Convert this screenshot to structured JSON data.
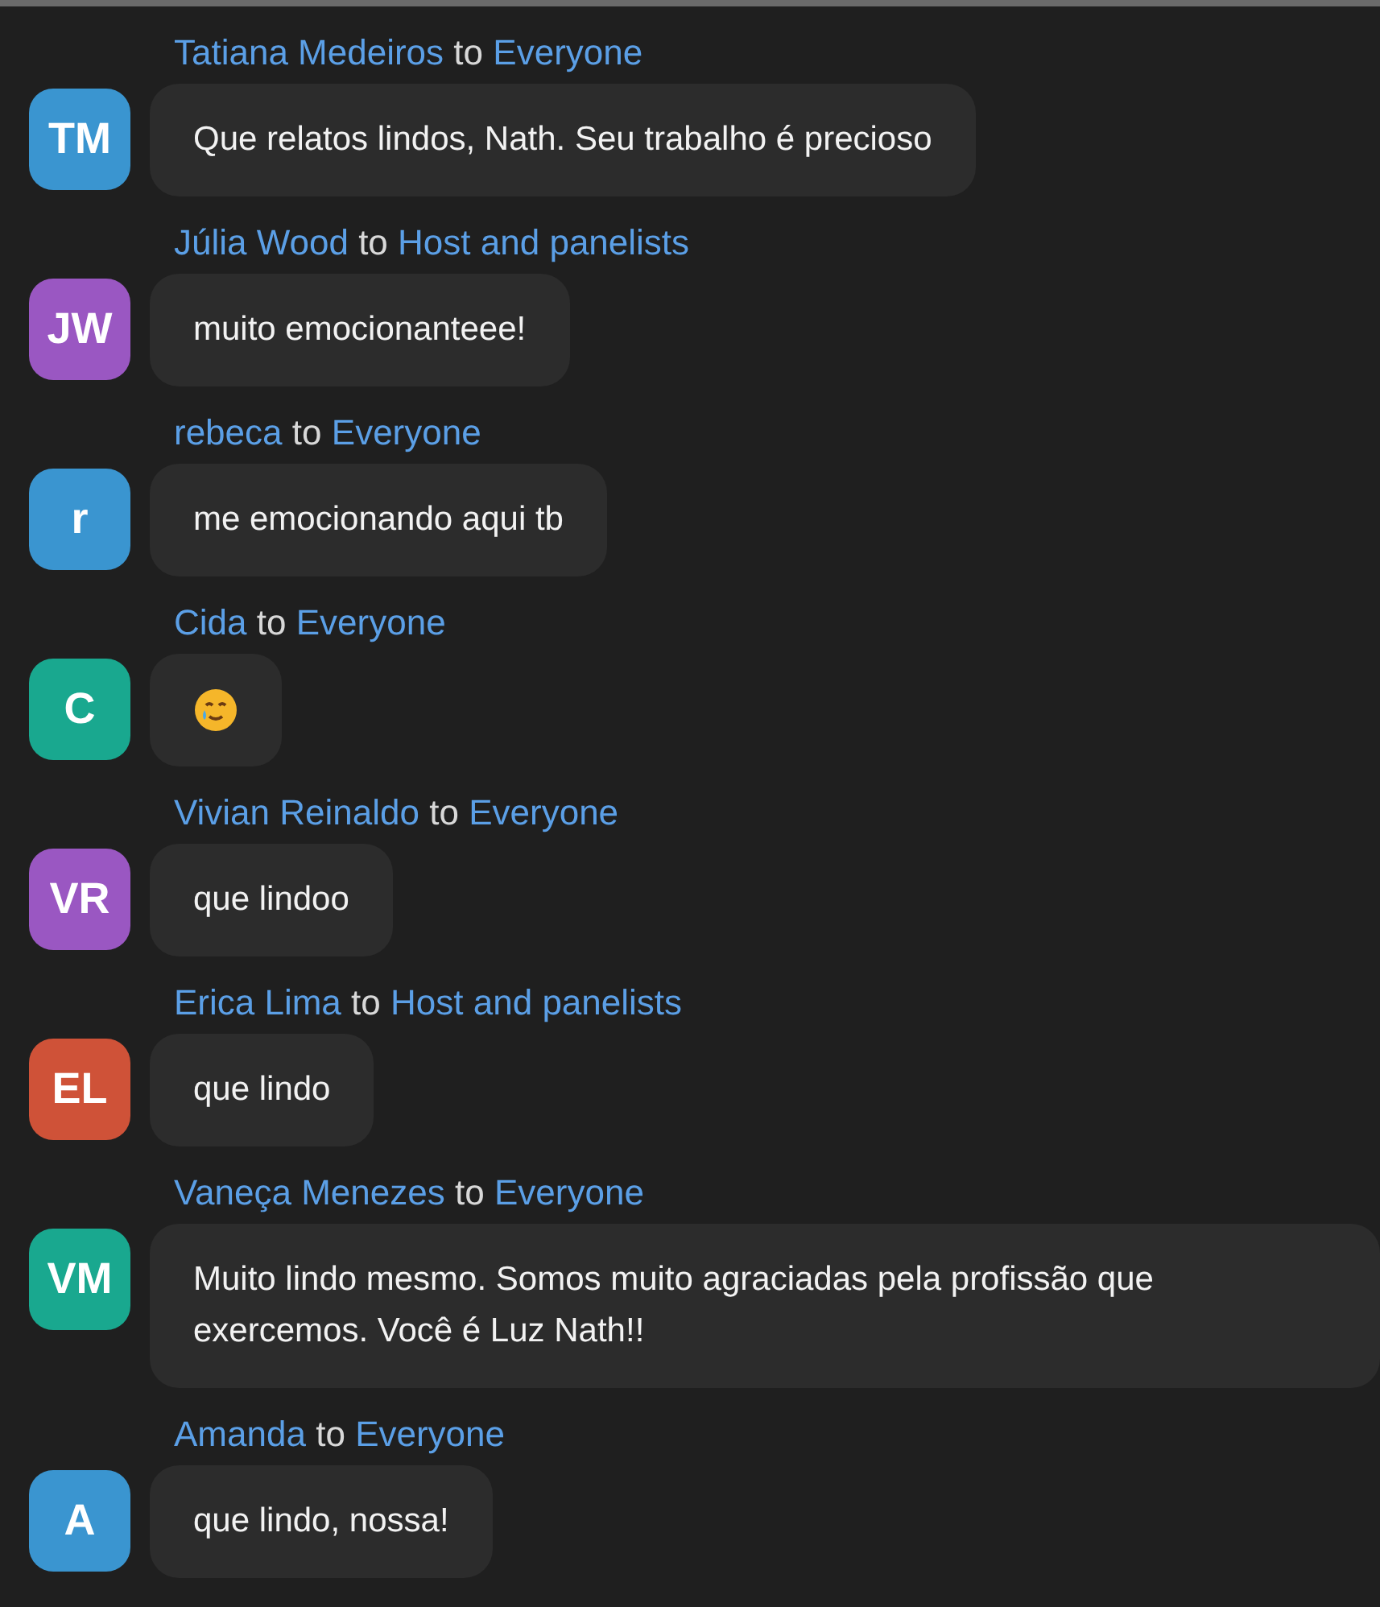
{
  "messages": [
    {
      "initials": "TM",
      "color": "#3a95d0",
      "sender": "Tatiana Medeiros",
      "connector": "to",
      "recipient": "Everyone",
      "kind": "text",
      "text": "Que relatos lindos, Nath. Seu trabalho é precioso"
    },
    {
      "initials": "JW",
      "color": "#9a57c2",
      "sender": "Júlia Wood",
      "connector": "to",
      "recipient": "Host and panelists",
      "kind": "text",
      "text": "muito emocionanteee!"
    },
    {
      "initials": "r",
      "color": "#3a95d0",
      "sender": "rebeca",
      "connector": "to",
      "recipient": "Everyone",
      "kind": "text",
      "text": "me emocionando aqui tb"
    },
    {
      "initials": "C",
      "color": "#19a88f",
      "sender": "Cida",
      "connector": "to",
      "recipient": "Everyone",
      "kind": "emoji"
    },
    {
      "initials": "VR",
      "color": "#9a57c2",
      "sender": "Vivian Reinaldo",
      "connector": "to",
      "recipient": "Everyone",
      "kind": "text",
      "text": "que lindoo"
    },
    {
      "initials": "EL",
      "color": "#cf5238",
      "sender": "Erica Lima",
      "connector": "to",
      "recipient": "Host and panelists",
      "kind": "text",
      "text": "que lindo"
    },
    {
      "initials": "VM",
      "color": "#19a88f",
      "sender": "Vaneça Menezes",
      "connector": "to",
      "recipient": "Everyone",
      "kind": "text",
      "text": "Muito lindo mesmo. Somos muito agraciadas pela profissão que exercemos. Você é Luz Nath!!"
    },
    {
      "initials": "A",
      "color": "#3a95d0",
      "sender": "Amanda",
      "connector": "to",
      "recipient": "Everyone",
      "kind": "text",
      "text": "que lindo, nossa!"
    }
  ]
}
